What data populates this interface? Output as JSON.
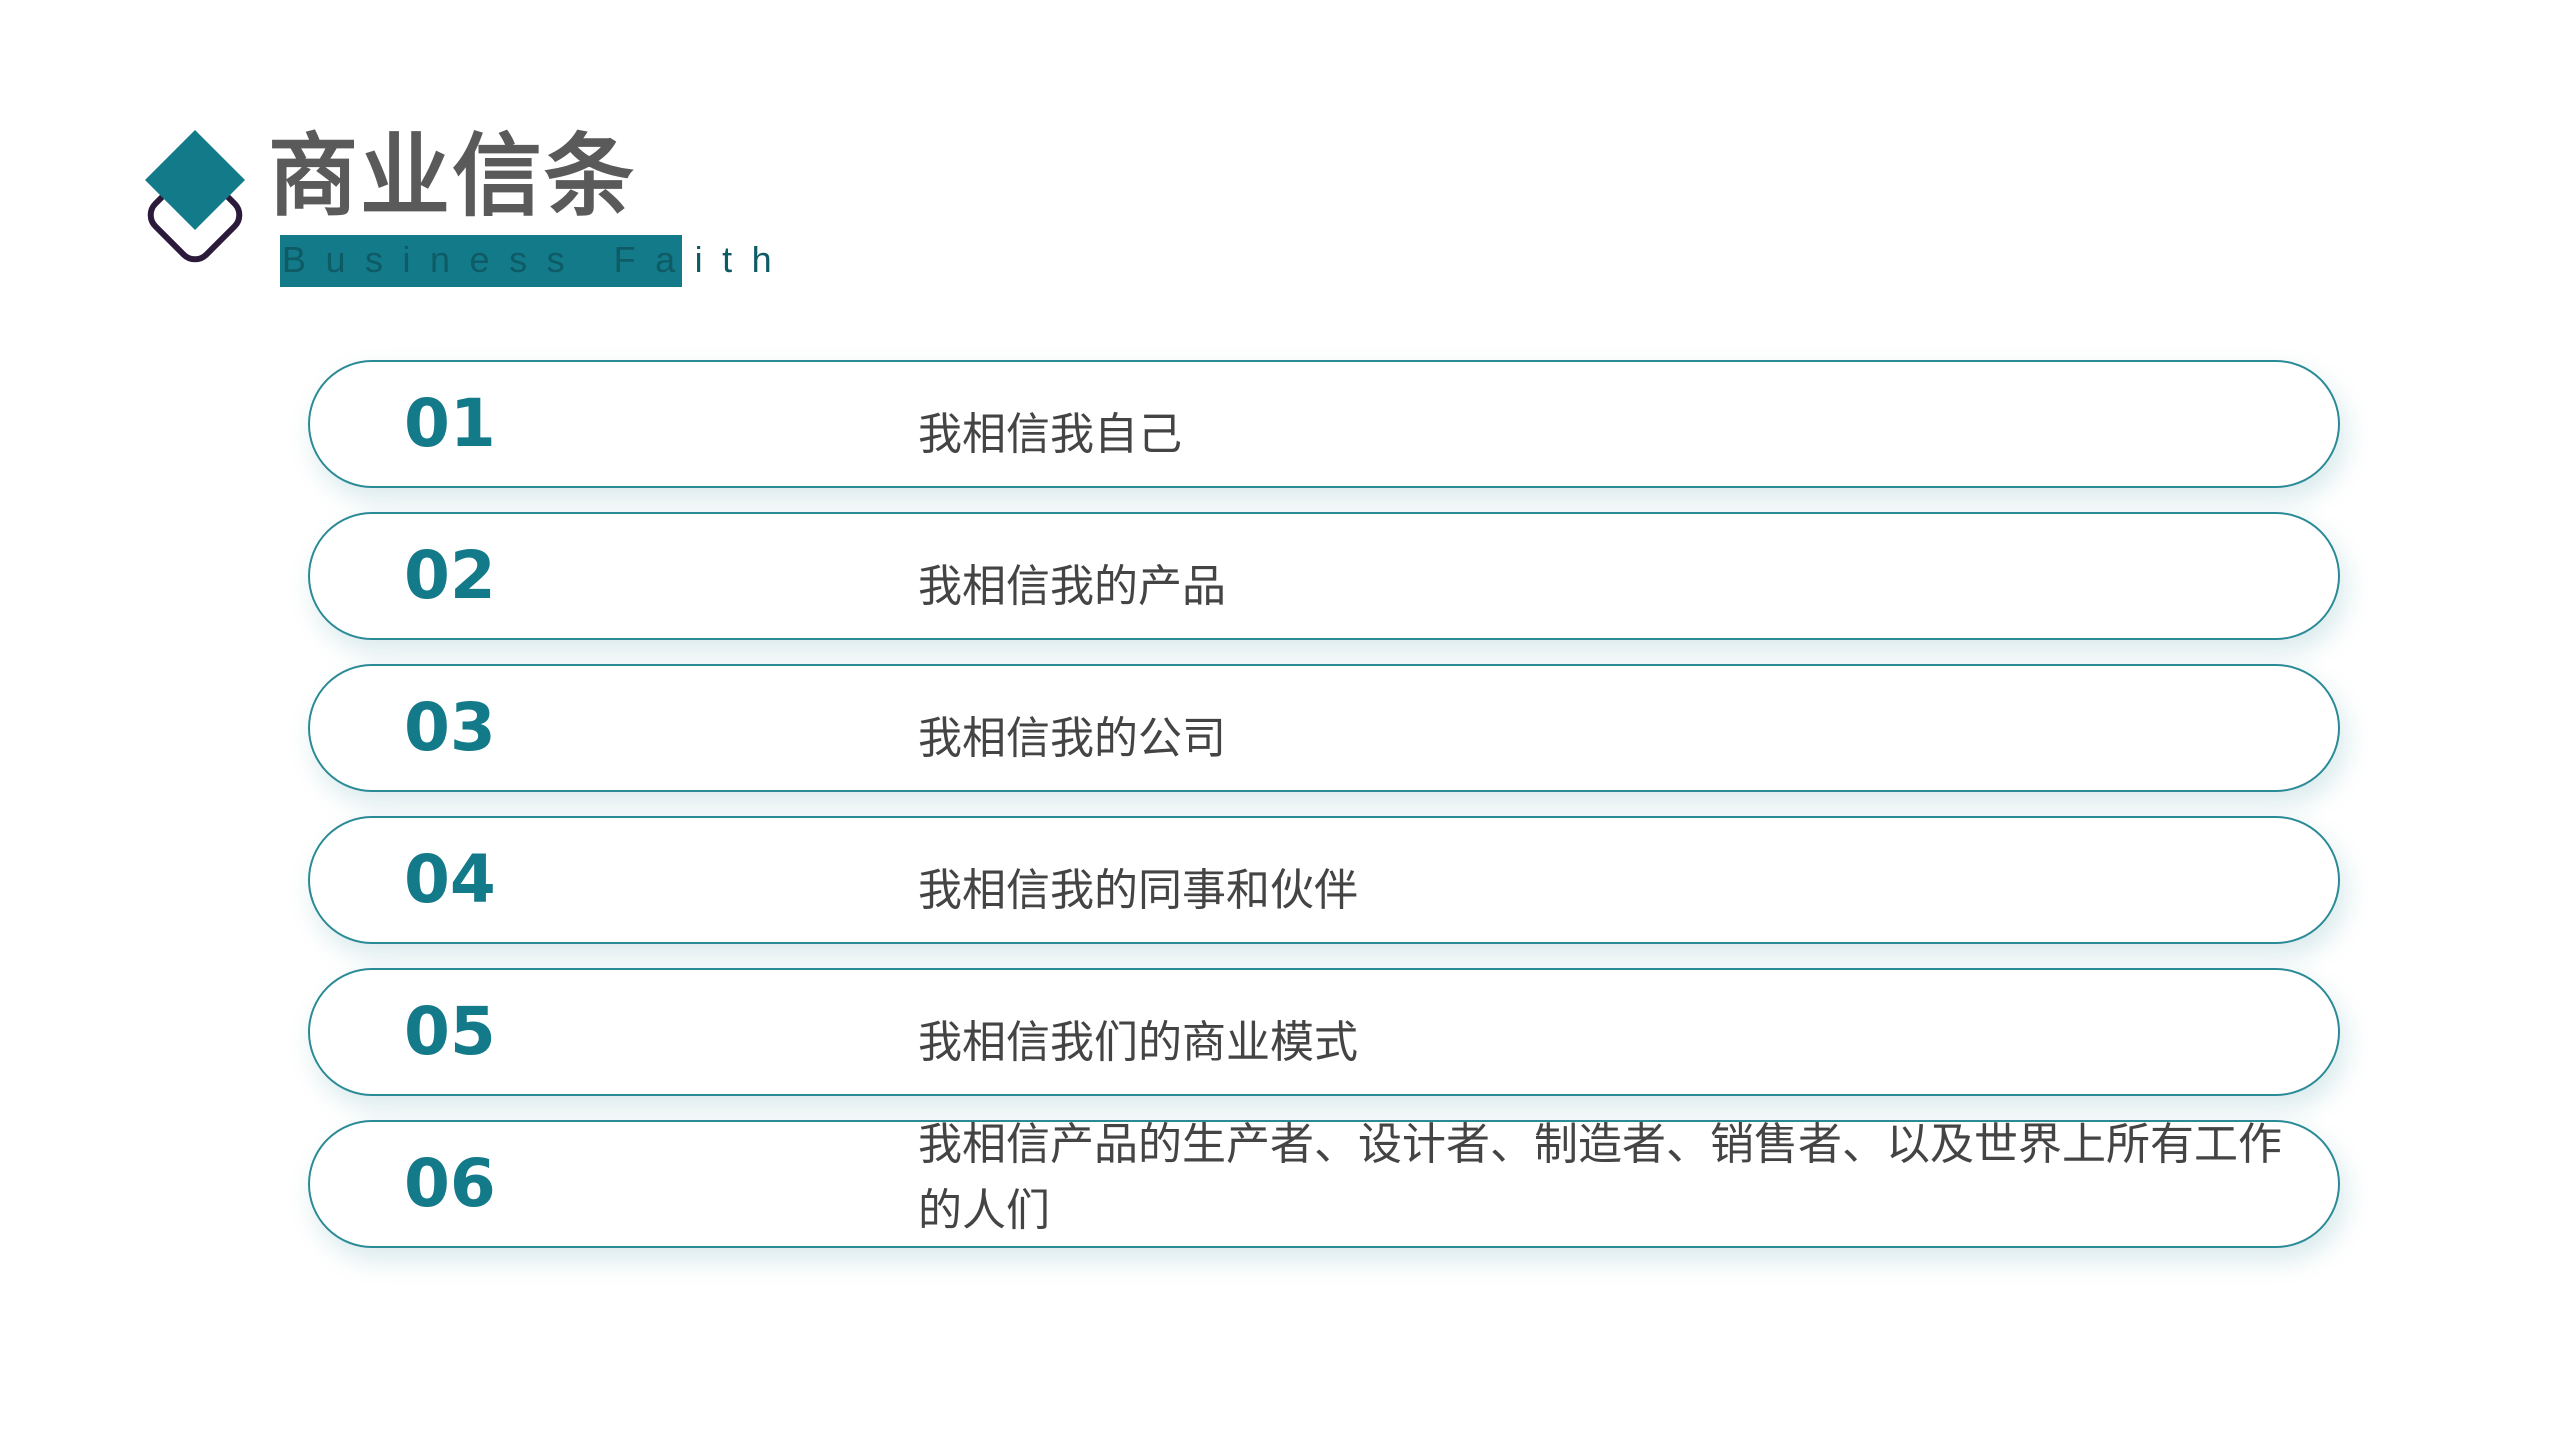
{
  "header": {
    "title": "商业信条",
    "subtitle": "Business Faith",
    "logo_icon": "diamond-logo-icon",
    "accent_color": "#137a8a",
    "outline_color": "#2c1a3a"
  },
  "items": [
    {
      "number": "01",
      "text": "我相信我自己"
    },
    {
      "number": "02",
      "text": "我相信我的产品"
    },
    {
      "number": "03",
      "text": "我相信我的公司"
    },
    {
      "number": "04",
      "text": "我相信我的同事和伙伴"
    },
    {
      "number": "05",
      "text": "我相信我们的商业模式"
    },
    {
      "number": "06",
      "text": "我相信产品的生产者、设计者、制造者、销售者、以及世界上所有工作的人们"
    }
  ]
}
